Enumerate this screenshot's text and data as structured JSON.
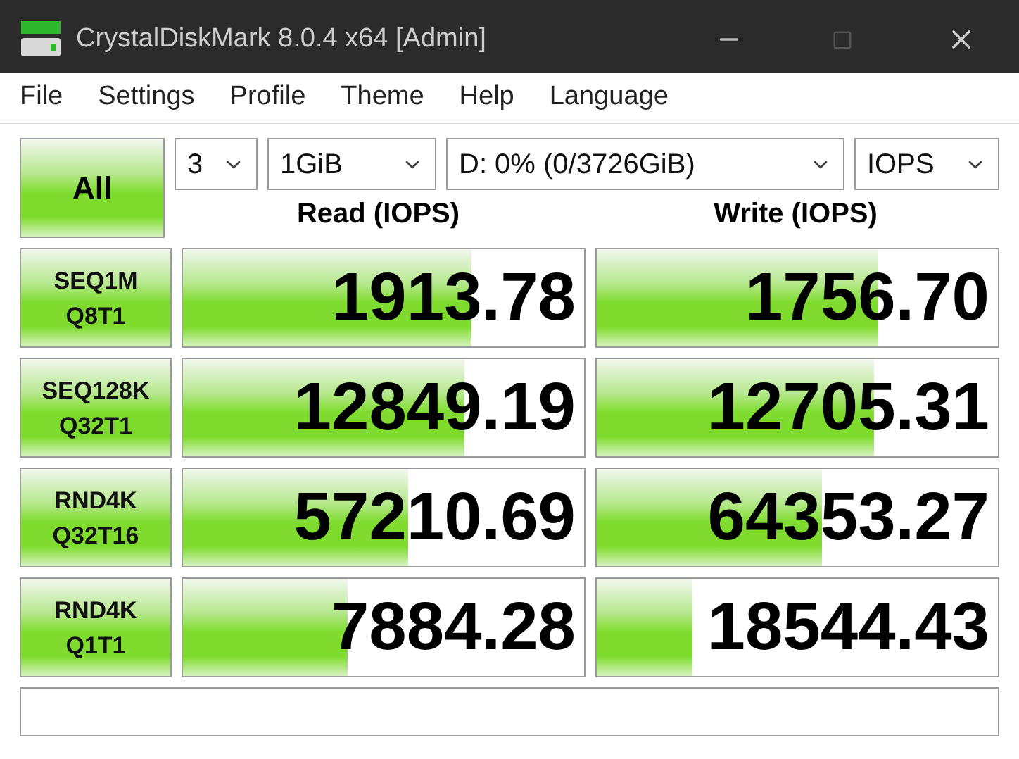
{
  "window": {
    "title": "CrystalDiskMark 8.0.4 x64 [Admin]"
  },
  "menu": [
    "File",
    "Settings",
    "Profile",
    "Theme",
    "Help",
    "Language"
  ],
  "all_button": "All",
  "selects": [
    {
      "value": "3"
    },
    {
      "value": "1GiB"
    },
    {
      "value": "D: 0% (0/3726GiB)"
    },
    {
      "value": "IOPS"
    }
  ],
  "headers": [
    "Read (IOPS)",
    "Write (IOPS)"
  ],
  "rows": [
    {
      "label": [
        "SEQ1M",
        "Q8T1"
      ],
      "read": {
        "value": "1913.78",
        "level": 0.72
      },
      "write": {
        "value": "1756.70",
        "level": 0.7
      }
    },
    {
      "label": [
        "SEQ128K",
        "Q32T1"
      ],
      "read": {
        "value": "12849.19",
        "level": 0.7
      },
      "write": {
        "value": "12705.31",
        "level": 0.69
      }
    },
    {
      "label": [
        "RND4K",
        "Q32T16"
      ],
      "read": {
        "value": "57210.69",
        "level": 0.56
      },
      "write": {
        "value": "64353.27",
        "level": 0.56
      }
    },
    {
      "label": [
        "RND4K",
        "Q1T1"
      ],
      "read": {
        "value": "7884.28",
        "level": 0.41
      },
      "write": {
        "value": "18544.43",
        "level": 0.24
      }
    }
  ]
}
